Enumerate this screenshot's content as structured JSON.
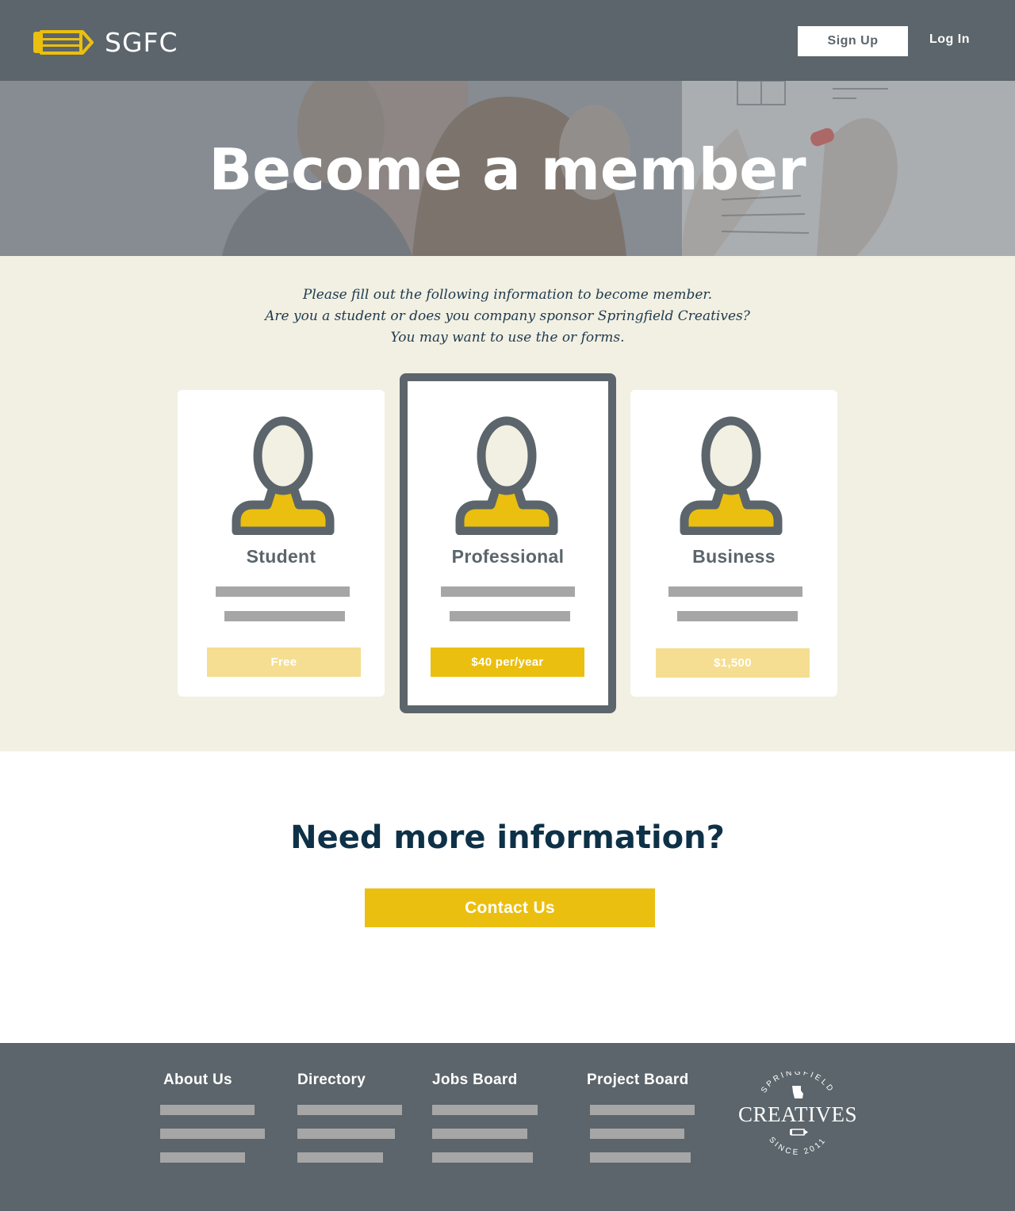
{
  "header": {
    "brand": "SGFC",
    "signup_label": "Sign Up",
    "login_label": "Log In"
  },
  "hero": {
    "title": "Become a member"
  },
  "intro": {
    "lines": [
      "Please fill out the following information to become member.",
      "Are you a student or does you company sponsor Springfield Creatives?",
      "You may want to use the or forms."
    ]
  },
  "plans": [
    {
      "title": "Student",
      "price": "Free",
      "featured": false,
      "icon": "person-icon"
    },
    {
      "title": "Professional",
      "price": "$40 per/year",
      "featured": true,
      "icon": "person-icon"
    },
    {
      "title": "Business",
      "price": "$1,500",
      "featured": false,
      "icon": "person-icon"
    }
  ],
  "info": {
    "title": "Need more information?",
    "contact_label": "Contact Us"
  },
  "footer": {
    "columns": [
      {
        "title": "About Us"
      },
      {
        "title": "Directory"
      },
      {
        "title": "Jobs Board"
      },
      {
        "title": "Project Board"
      }
    ],
    "seal": {
      "top_arc": "SPRINGFIELD",
      "name": "CREATIVES",
      "bottom_arc": "SINCE 2011"
    }
  },
  "colors": {
    "header_bg": "#5b656b",
    "cream_bg": "#f2f0e3",
    "accent_yellow": "#ebbf0f",
    "accent_yellow_light": "#f5de91",
    "heading_navy": "#0e3147",
    "placeholder_gray": "#a6a6a6"
  }
}
